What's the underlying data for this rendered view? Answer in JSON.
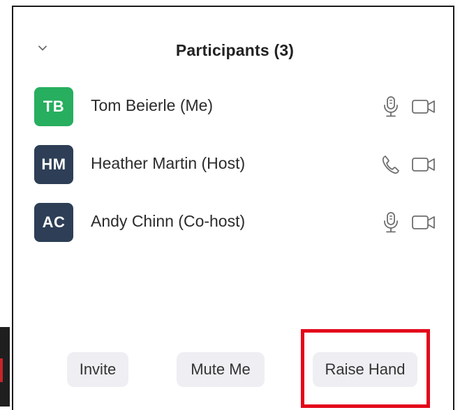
{
  "panel": {
    "title": "Participants (3)"
  },
  "participants": [
    {
      "initials": "TB",
      "name": "Tom Beierle (Me)",
      "avatar_color": "#27ae5f",
      "audio_icon": "microphone-icon",
      "video_icon": "video-camera-icon"
    },
    {
      "initials": "HM",
      "name": "Heather Martin (Host)",
      "avatar_color": "#2d3e56",
      "audio_icon": "phone-icon",
      "video_icon": "video-camera-icon"
    },
    {
      "initials": "AC",
      "name": "Andy Chinn (Co-host)",
      "avatar_color": "#2d3e56",
      "audio_icon": "microphone-icon",
      "video_icon": "video-camera-icon"
    }
  ],
  "buttons": {
    "invite": "Invite",
    "mute_me": "Mute Me",
    "raise_hand": "Raise Hand"
  },
  "colors": {
    "highlight": "#e3071a",
    "button_bg": "#eeeef3",
    "icon_stroke": "#6e6e6e"
  }
}
